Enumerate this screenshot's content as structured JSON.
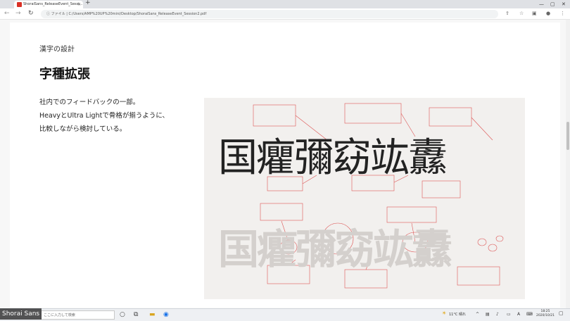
{
  "browser": {
    "tab_title": "ShoraiSans_ReleaseEvent_Sessi...",
    "url_prefix": "ファイル",
    "url": "C:/Users/AMP%20UP%20mini/Desktop/ShoraiSans_ReleaseEvent_Session2.pdf"
  },
  "slide": {
    "breadcrumb": "漢字の設計",
    "title": "字種拡張",
    "body_lines": [
      "社内でのフィードバックの一部。",
      "HeavyとUltra Lightで骨格が揃うように、",
      "比較しながら検討している。"
    ],
    "kanji_light": "国癯彌窈竑纛",
    "kanji_heavy": "国癯彌窈竑纛"
  },
  "zoom": {
    "participant_name": "Shorai Sans"
  },
  "taskbar": {
    "search_placeholder": "ここに入力して検索",
    "weather": "11°C 晴れ",
    "time": "18:25",
    "date": "2020/10/21",
    "ime": "A"
  }
}
